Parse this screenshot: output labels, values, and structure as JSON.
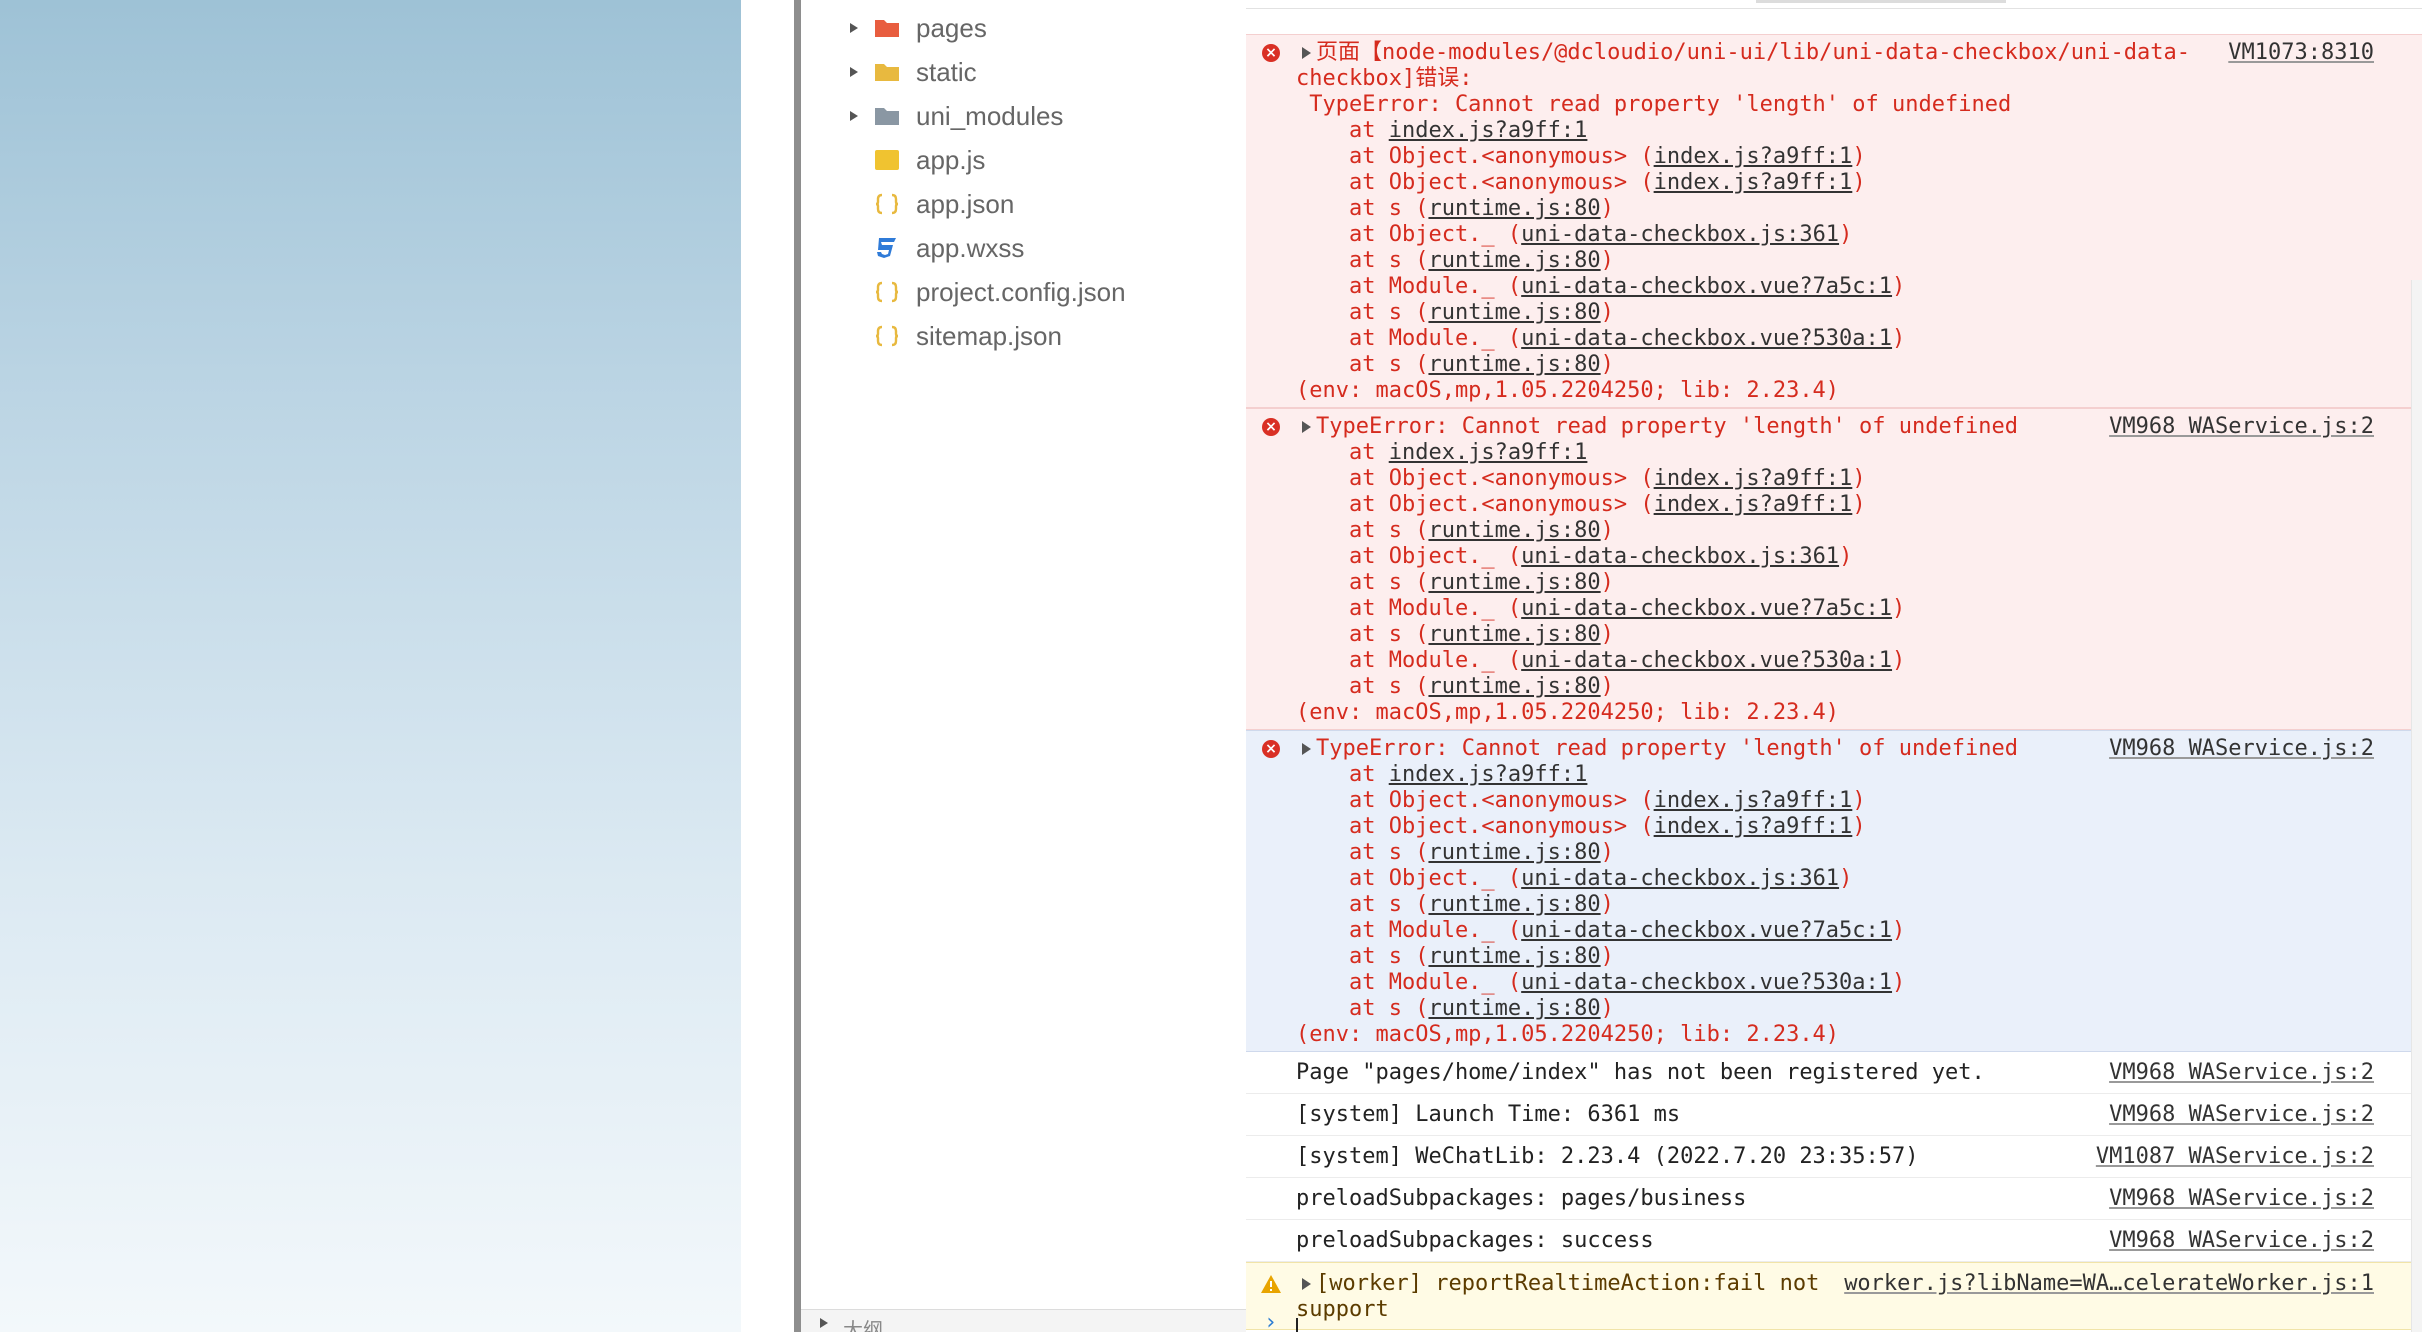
{
  "explorer": {
    "items": [
      {
        "name": "pages",
        "kind": "folder",
        "color": "#e85d3f",
        "expandable": true
      },
      {
        "name": "static",
        "kind": "folder",
        "color": "#e8b93f",
        "expandable": true
      },
      {
        "name": "uni_modules",
        "kind": "folder",
        "color": "#8a97a3",
        "expandable": true
      },
      {
        "name": "app.js",
        "kind": "js-file",
        "color": "#f0c330",
        "expandable": false
      },
      {
        "name": "app.json",
        "kind": "json-file",
        "color": "#e8b93f",
        "expandable": false
      },
      {
        "name": "app.wxss",
        "kind": "css-file",
        "color": "#2f7bd8",
        "expandable": false
      },
      {
        "name": "project.config.json",
        "kind": "json-file",
        "color": "#e8b93f",
        "expandable": false
      },
      {
        "name": "sitemap.json",
        "kind": "json-file",
        "color": "#e8b93f",
        "expandable": false
      }
    ],
    "outline_label": "大纲"
  },
  "console": {
    "messages": [
      {
        "type": "error",
        "source": "VM1073:8310",
        "lines": [
          {
            "text": "页面【node-modules/@dcloudio/uni-ui/lib/uni-data-checkbox/uni-data-"
          },
          {
            "text": "checkbox]错误:"
          },
          {
            "text": " TypeError: Cannot read property 'length' of undefined"
          },
          {
            "pre": "    at ",
            "link": "index.js?a9ff:1",
            "post": ""
          },
          {
            "pre": "    at Object.<anonymous> (",
            "link": "index.js?a9ff:1",
            "post": ")"
          },
          {
            "pre": "    at Object.<anonymous> (",
            "link": "index.js?a9ff:1",
            "post": ")"
          },
          {
            "pre": "    at s (",
            "link": "runtime.js:80",
            "post": ")"
          },
          {
            "pre": "    at Object._ (",
            "link": "uni-data-checkbox.js:361",
            "post": ")"
          },
          {
            "pre": "    at s (",
            "link": "runtime.js:80",
            "post": ")"
          },
          {
            "pre": "    at Module._ (",
            "link": "uni-data-checkbox.vue?7a5c:1",
            "post": ")"
          },
          {
            "pre": "    at s (",
            "link": "runtime.js:80",
            "post": ")"
          },
          {
            "pre": "    at Module._ (",
            "link": "uni-data-checkbox.vue?530a:1",
            "post": ")"
          },
          {
            "pre": "    at s (",
            "link": "runtime.js:80",
            "post": ")"
          },
          {
            "text": "(env: macOS,mp,1.05.2204250; lib: 2.23.4)"
          }
        ]
      },
      {
        "type": "error",
        "source": "VM968 WAService.js:2",
        "lines": [
          {
            "text": "TypeError: Cannot read property 'length' of undefined"
          },
          {
            "pre": "    at ",
            "link": "index.js?a9ff:1",
            "post": ""
          },
          {
            "pre": "    at Object.<anonymous> (",
            "link": "index.js?a9ff:1",
            "post": ")"
          },
          {
            "pre": "    at Object.<anonymous> (",
            "link": "index.js?a9ff:1",
            "post": ")"
          },
          {
            "pre": "    at s (",
            "link": "runtime.js:80",
            "post": ")"
          },
          {
            "pre": "    at Object._ (",
            "link": "uni-data-checkbox.js:361",
            "post": ")"
          },
          {
            "pre": "    at s (",
            "link": "runtime.js:80",
            "post": ")"
          },
          {
            "pre": "    at Module._ (",
            "link": "uni-data-checkbox.vue?7a5c:1",
            "post": ")"
          },
          {
            "pre": "    at s (",
            "link": "runtime.js:80",
            "post": ")"
          },
          {
            "pre": "    at Module._ (",
            "link": "uni-data-checkbox.vue?530a:1",
            "post": ")"
          },
          {
            "pre": "    at s (",
            "link": "runtime.js:80",
            "post": ")"
          },
          {
            "text": "(env: macOS,mp,1.05.2204250; lib: 2.23.4)"
          }
        ]
      },
      {
        "type": "error",
        "selected": true,
        "source": "VM968 WAService.js:2",
        "lines": [
          {
            "text": "TypeError: Cannot read property 'length' of undefined"
          },
          {
            "pre": "    at ",
            "link": "index.js?a9ff:1",
            "post": ""
          },
          {
            "pre": "    at Object.<anonymous> (",
            "link": "index.js?a9ff:1",
            "post": ")"
          },
          {
            "pre": "    at Object.<anonymous> (",
            "link": "index.js?a9ff:1",
            "post": ")"
          },
          {
            "pre": "    at s (",
            "link": "runtime.js:80",
            "post": ")"
          },
          {
            "pre": "    at Object._ (",
            "link": "uni-data-checkbox.js:361",
            "post": ")"
          },
          {
            "pre": "    at s (",
            "link": "runtime.js:80",
            "post": ")"
          },
          {
            "pre": "    at Module._ (",
            "link": "uni-data-checkbox.vue?7a5c:1",
            "post": ")"
          },
          {
            "pre": "    at s (",
            "link": "runtime.js:80",
            "post": ")"
          },
          {
            "pre": "    at Module._ (",
            "link": "uni-data-checkbox.vue?530a:1",
            "post": ")"
          },
          {
            "pre": "    at s (",
            "link": "runtime.js:80",
            "post": ")"
          },
          {
            "text": "(env: macOS,mp,1.05.2204250; lib: 2.23.4)"
          }
        ]
      },
      {
        "type": "log",
        "source": "VM968 WAService.js:2",
        "lines": [
          {
            "text": "Page \"pages/home/index\" has not been registered yet."
          }
        ]
      },
      {
        "type": "log",
        "source": "VM968 WAService.js:2",
        "lines": [
          {
            "text": "[system] Launch Time: 6361 ms"
          }
        ]
      },
      {
        "type": "log",
        "source": "VM1087 WAService.js:2",
        "lines": [
          {
            "text": "[system] WeChatLib: 2.23.4 (2022.7.20 23:35:57)"
          }
        ]
      },
      {
        "type": "log",
        "source": "VM968 WAService.js:2",
        "lines": [
          {
            "text": "preloadSubpackages: pages/business"
          }
        ]
      },
      {
        "type": "log",
        "source": "VM968 WAService.js:2",
        "lines": [
          {
            "text": "preloadSubpackages: success"
          }
        ]
      },
      {
        "type": "warn",
        "source": "worker.js?libName=WA…celerateWorker.js:1",
        "lines": [
          {
            "text": "[worker] reportRealtimeAction:fail not"
          },
          {
            "text": "support"
          }
        ]
      }
    ],
    "prompt_symbol": "›",
    "colors": {
      "error": "#d52b1e",
      "error_bg": "#fdeeee",
      "selected_bg": "#eaf0fa",
      "warn_bg": "#fffbe5"
    }
  }
}
